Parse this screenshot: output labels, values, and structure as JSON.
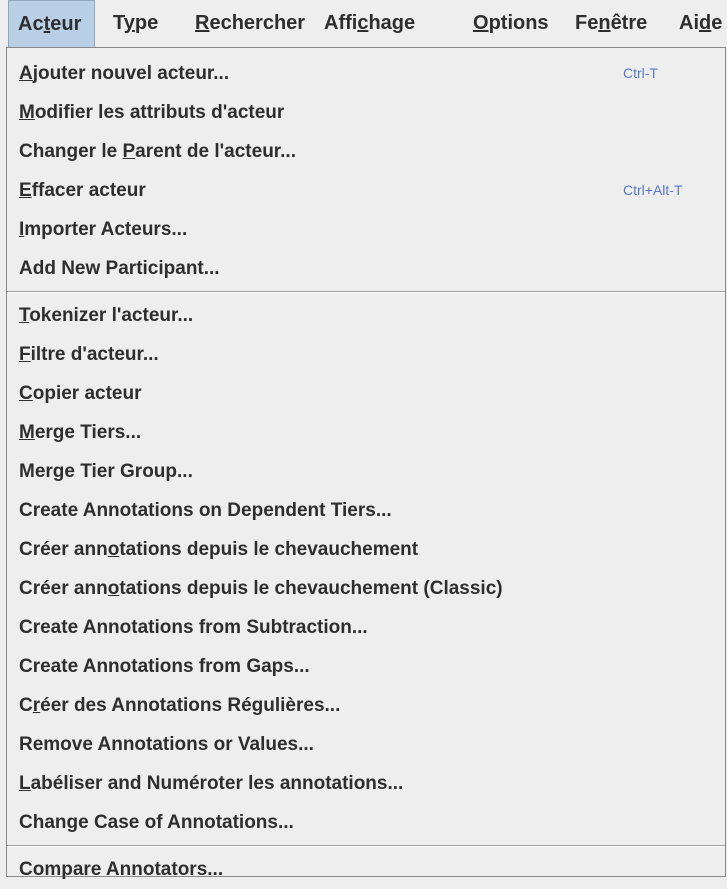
{
  "menubar": {
    "items": [
      {
        "id": "acteur",
        "label": "Acteur",
        "mnemonic": "t",
        "active": true
      },
      {
        "id": "type",
        "label": "Type",
        "mnemonic": "y"
      },
      {
        "id": "rechercher",
        "label": "Rechercher",
        "mnemonic": "R"
      },
      {
        "id": "affichage",
        "label": "Affichage",
        "mnemonic": "c"
      },
      {
        "id": "options",
        "label": "Options",
        "mnemonic": "O"
      },
      {
        "id": "fenetre",
        "label": "Fenêtre",
        "mnemonic": "n"
      },
      {
        "id": "aide",
        "label": "Aide",
        "mnemonic": "d"
      }
    ]
  },
  "acteur_menu": {
    "groups": [
      [
        {
          "label": "Ajouter nouvel acteur...",
          "mnemonic_index": 0,
          "accelerator": "Ctrl-T"
        },
        {
          "label": "Modifier les attributs d'acteur",
          "mnemonic_index": 0
        },
        {
          "label": "Changer le Parent de l'acteur...",
          "mnemonic_index": 11
        },
        {
          "label": "Effacer acteur",
          "mnemonic_index": 0,
          "accelerator": "Ctrl+Alt-T"
        },
        {
          "label": "Importer Acteurs...",
          "mnemonic_index": 0
        },
        {
          "label": "Add New Participant...",
          "mnemonic_index": -1
        }
      ],
      [
        {
          "label": "Tokenizer l'acteur...",
          "mnemonic_index": 0
        },
        {
          "label": "Filtre d'acteur...",
          "mnemonic_index": 0
        },
        {
          "label": "Copier acteur",
          "mnemonic_index": 0
        },
        {
          "label": "Merge Tiers...",
          "mnemonic_index": 0
        },
        {
          "label": "Merge Tier Group...",
          "mnemonic_index": -1
        },
        {
          "label": "Create Annotations on Dependent Tiers...",
          "mnemonic_index": -1
        },
        {
          "label": "Créer annotations depuis le chevauchement",
          "mnemonic_index": 9
        },
        {
          "label": "Créer annotations depuis le chevauchement (Classic)",
          "mnemonic_index": 9
        },
        {
          "label": "Create Annotations from Subtraction...",
          "mnemonic_index": -1
        },
        {
          "label": "Create Annotations from Gaps...",
          "mnemonic_index": 31
        },
        {
          "label": "Créer des Annotations Régulières...",
          "mnemonic_index": 1
        },
        {
          "label": "Remove Annotations or Values...",
          "mnemonic_index": -1
        },
        {
          "label": "Labéliser and Numéroter les annotations...",
          "mnemonic_index": 0
        },
        {
          "label": "Change Case of Annotations...",
          "mnemonic_index": 4
        }
      ],
      [
        {
          "label": "Compare Annotators...",
          "mnemonic_index": -1
        }
      ]
    ]
  }
}
